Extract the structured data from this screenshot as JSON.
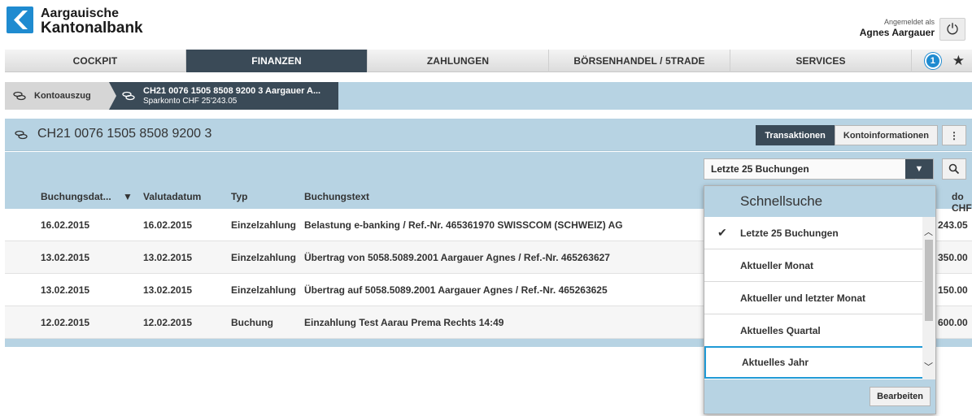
{
  "header": {
    "logo_line1": "Aargauische",
    "logo_line2": "Kantonalbank",
    "logged_in_label": "Angemeldet als",
    "user_name": "Agnes Aargauer",
    "brand_color": "#1f8bd0"
  },
  "nav": {
    "tabs": [
      {
        "label": "COCKPIT"
      },
      {
        "label": "FINANZEN"
      },
      {
        "label": "ZAHLUNGEN"
      },
      {
        "label": "BÖRSENHANDEL / 5TRADE"
      },
      {
        "label": "SERVICES"
      }
    ],
    "active_index": 1,
    "notification_count": "1"
  },
  "breadcrumb": {
    "item1": "Kontoauszug",
    "item2_title": "CH21 0076 1505 8508 9200 3 Aargauer A...",
    "item2_sub": "Sparkonto CHF 25'243.05"
  },
  "account": {
    "iban": "CH21 0076 1505 8508 9200 3",
    "btn_transactions": "Transaktionen",
    "btn_info": "Kontoinformationen",
    "more": "⋮"
  },
  "filter": {
    "selected": "Letzte 25 Buchungen"
  },
  "table": {
    "headers": {
      "booking_date": "Buchungsdat...",
      "value_date": "Valutadatum",
      "type": "Typ",
      "text": "Buchungstext",
      "balance": "do CHF"
    },
    "rows": [
      {
        "booking_date": "16.02.2015",
        "value_date": "16.02.2015",
        "type": "Einzelzahlung",
        "text": "Belastung e-banking / Ref.-Nr. 465361970 SWISSCOM (SCHWEIZ) AG",
        "balance": "243.05"
      },
      {
        "booking_date": "13.02.2015",
        "value_date": "13.02.2015",
        "type": "Einzelzahlung",
        "text": "Übertrag von 5058.5089.2001 Aargauer Agnes / Ref.-Nr. 465263627",
        "balance": "350.00"
      },
      {
        "booking_date": "13.02.2015",
        "value_date": "13.02.2015",
        "type": "Einzelzahlung",
        "text": "Übertrag auf 5058.5089.2001 Aargauer Agnes / Ref.-Nr. 465263625",
        "balance": "150.00"
      },
      {
        "booking_date": "12.02.2015",
        "value_date": "12.02.2015",
        "type": "Buchung",
        "text": "Einzahlung Test Aarau Prema Rechts 14:49",
        "balance": "600.00"
      }
    ]
  },
  "quicksearch": {
    "title": "Schnellsuche",
    "items": [
      {
        "label": "Letzte 25 Buchungen"
      },
      {
        "label": "Aktueller Monat"
      },
      {
        "label": "Aktueller und letzter Monat"
      },
      {
        "label": "Aktuelles Quartal"
      },
      {
        "label": "Aktuelles Jahr"
      }
    ],
    "edit_button": "Bearbeiten"
  }
}
